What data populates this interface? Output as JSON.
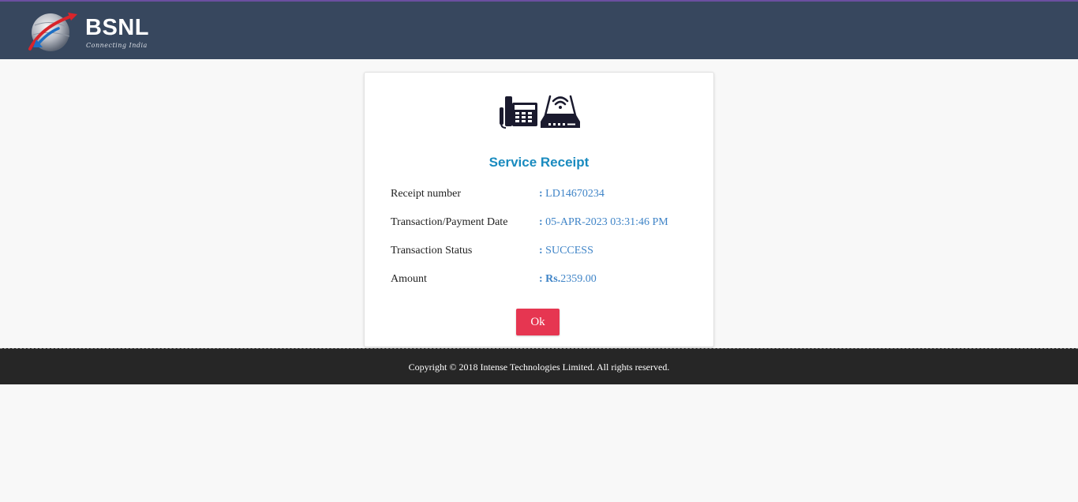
{
  "header": {
    "brand": "BSNL",
    "tagline": "Connecting India"
  },
  "receipt": {
    "title": "Service Receipt",
    "rows": [
      {
        "label": "Receipt number",
        "separator": ": ",
        "prefix": "",
        "value": "LD14670234"
      },
      {
        "label": "Transaction/Payment Date",
        "separator": ": ",
        "prefix": "",
        "value": "05-APR-2023 03:31:46 PM"
      },
      {
        "label": "Transaction Status",
        "separator": ": ",
        "prefix": "",
        "value": "SUCCESS"
      },
      {
        "label": "Amount",
        "separator": ": ",
        "prefix": "Rs.",
        "value": "2359.00"
      }
    ],
    "ok_label": "Ok"
  },
  "footer": {
    "copyright": "Copyright © 2018 Intense Technologies Limited. All rights reserved."
  },
  "icons": {
    "logo": "bsnl-logo-icon",
    "device": "telephone-router-icon"
  },
  "colors": {
    "header_bg": "#37475e",
    "title": "#1a8bbf",
    "value": "#3f84c7",
    "ok_button": "#e63651",
    "footer_bg": "#262626"
  }
}
